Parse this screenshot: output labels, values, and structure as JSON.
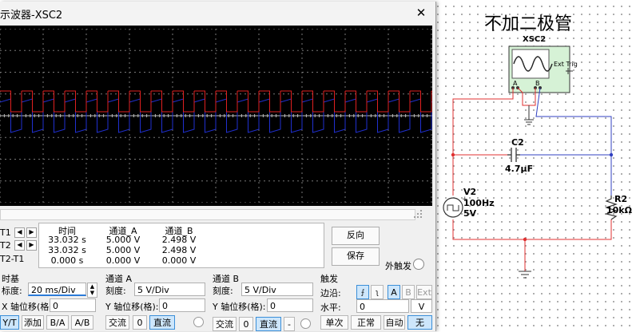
{
  "window": {
    "title": "示波器-XSC2",
    "close_symbol": "✕"
  },
  "cursors": {
    "labels": [
      "T1",
      "T2",
      "T2-T1"
    ],
    "headers": {
      "time": "时间",
      "ch_a": "通道_A",
      "ch_b": "通道_B"
    },
    "rows": [
      {
        "time": "33.032 s",
        "ch_a": "5.000 V",
        "ch_b": "2.498 V"
      },
      {
        "time": "33.032 s",
        "ch_a": "5.000 V",
        "ch_b": "2.498 V"
      },
      {
        "time": "0.000 s",
        "ch_a": "0.000 V",
        "ch_b": "0.000 V"
      }
    ]
  },
  "buttons": {
    "reverse": "反向",
    "save": "保存",
    "ext_trigger": "外触发"
  },
  "timebase": {
    "title": "时基",
    "scale_label": "标度:",
    "scale_value": "20 ms/Div",
    "xpos_label": "X 轴位移(格):",
    "xpos_value": "0",
    "modes": [
      "Y/T",
      "添加",
      "B/A",
      "A/B"
    ],
    "active_mode": "Y/T"
  },
  "channel_a": {
    "title": "通道 A",
    "scale_label": "刻度:",
    "scale_value": "5  V/Div",
    "ypos_label": "Y 轴位移(格):",
    "ypos_value": "0",
    "coupling": [
      "交流",
      "0",
      "直流"
    ],
    "active_coupling": "直流"
  },
  "channel_b": {
    "title": "通道 B",
    "scale_label": "刻度:",
    "scale_value": "5  V/Div",
    "ypos_label": "Y 轴位移(格):",
    "ypos_value": "0",
    "coupling": [
      "交流",
      "0",
      "直流",
      "-"
    ],
    "active_coupling": "直流"
  },
  "trigger": {
    "title": "触发",
    "edge_label": "边沿:",
    "level_label": "水平:",
    "level_value": "0",
    "level_unit": "V",
    "edge_sources": [
      "A",
      "B",
      "Ext"
    ],
    "active_source": "A",
    "modes": [
      "单次",
      "正常",
      "自动",
      "无"
    ],
    "active_mode": "无"
  },
  "schematic": {
    "title": "不加二极管",
    "scope_label": "XSC2",
    "scope_ext_trig": "Ext Trig",
    "scope_a": "A",
    "scope_b": "B",
    "capacitor": {
      "name": "C2",
      "value": "4.7µF"
    },
    "source": {
      "name": "V2",
      "freq": "100Hz",
      "amp": "5V"
    },
    "resistor": {
      "name": "R2",
      "value": "10kΩ"
    }
  },
  "colors": {
    "channel_a": "#e02020",
    "channel_b": "#2030d0",
    "wire_red": "#e03030",
    "wire_blue": "#3040c0",
    "active_bg": "#cde6fb"
  }
}
